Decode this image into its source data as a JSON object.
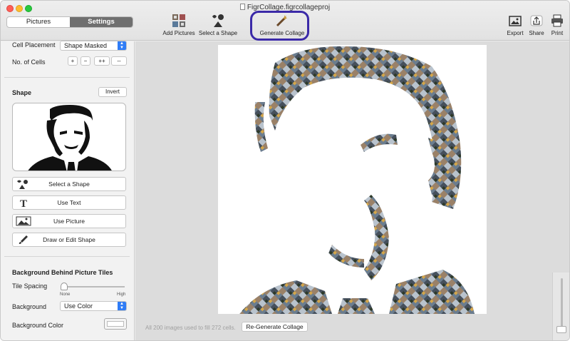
{
  "window": {
    "title": "FigrCollage.figrcollageproj"
  },
  "sidebar_tabs": [
    {
      "label": "Pictures",
      "active": false
    },
    {
      "label": "Settings",
      "active": true
    }
  ],
  "toolbar": {
    "add_pictures": "Add Pictures",
    "select_shape": "Select a Shape",
    "generate_collage": "Generate Collage",
    "export": "Export",
    "share": "Share",
    "print": "Print"
  },
  "settings": {
    "cell_placement_label": "Cell Placement",
    "cell_placement_value": "Shape Masked",
    "cells_label": "No. of Cells",
    "cell_buttons": [
      "+",
      "−",
      "++",
      "--"
    ],
    "shape_heading": "Shape",
    "invert_label": "Invert",
    "shape_buttons": {
      "select_shape": "Select a Shape",
      "use_text": "Use Text",
      "use_picture": "Use Picture",
      "draw_edit": "Draw or Edit Shape"
    },
    "background_heading": "Background Behind Picture Tiles",
    "tile_spacing_label": "Tile Spacing",
    "tile_spacing_min": "None",
    "tile_spacing_max": "High",
    "tile_spacing_value": 0,
    "background_label": "Background",
    "background_value": "Use Color",
    "background_color_label": "Background Color",
    "background_color": "#ffffff"
  },
  "status": {
    "message": "All 200 images used to fill 272 cells.",
    "regenerate_label": "Re-Generate Collage"
  },
  "colors": {
    "accent": "#2f7cf6",
    "highlight": "#3b2aa8"
  }
}
